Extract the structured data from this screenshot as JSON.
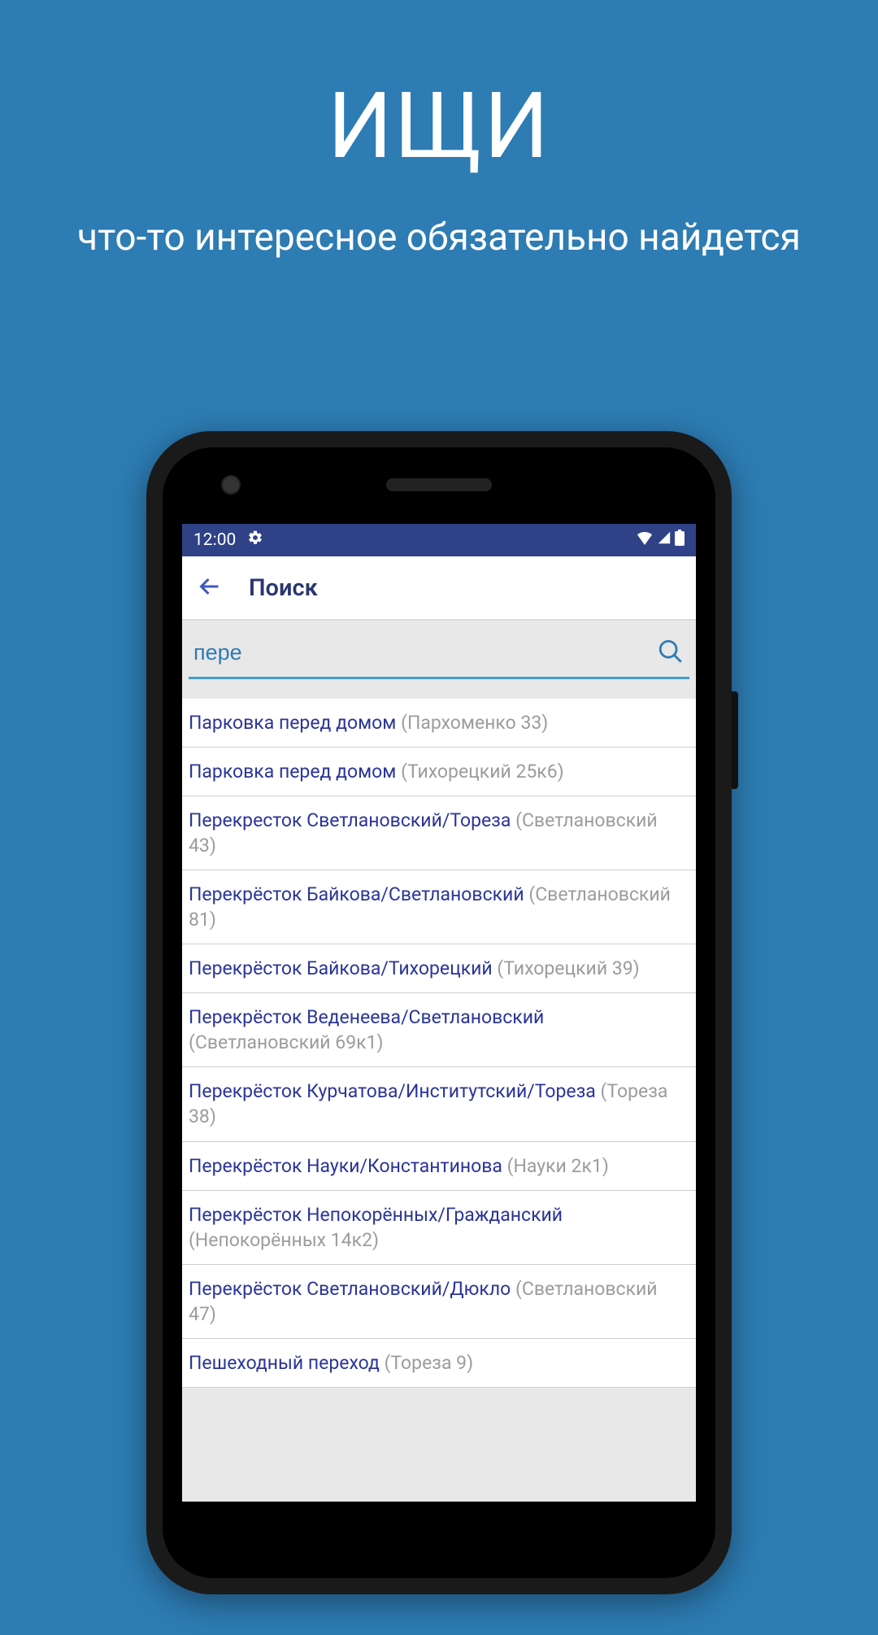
{
  "hero": {
    "title": "ИЩИ",
    "subtitle": "что-то интересное обязательно найдется"
  },
  "status_bar": {
    "time": "12:00"
  },
  "header": {
    "title": "Поиск"
  },
  "search": {
    "value": "пере"
  },
  "results": [
    {
      "title": "Парковка перед домом",
      "sub": "(Пархоменко 33)"
    },
    {
      "title": "Парковка перед домом",
      "sub": "(Тихорецкий 25к6)"
    },
    {
      "title": "Перекресток Светлановский/Тореза",
      "sub": "(Светлановский 43)"
    },
    {
      "title": "Перекрёсток Байкова/Светлановский",
      "sub": "(Светлановский 81)"
    },
    {
      "title": "Перекрёсток Байкова/Тихорецкий",
      "sub": "(Тихорецкий 39)"
    },
    {
      "title": "Перекрёсток Веденеева/Светлановский",
      "sub": "(Светлановский 69к1)"
    },
    {
      "title": "Перекрёсток Курчатова/Институтский/Тореза",
      "sub": "(Тореза 38)"
    },
    {
      "title": "Перекрёсток Науки/Константинова",
      "sub": "(Науки 2к1)"
    },
    {
      "title": "Перекрёсток Непокорённых/Гражданский",
      "sub": "(Непокорённых 14к2)"
    },
    {
      "title": "Перекрёсток Светлановский/Дюкло",
      "sub": "(Светлановский 47)"
    },
    {
      "title": "Пешеходный переход",
      "sub": "(Тореза 9)"
    }
  ]
}
